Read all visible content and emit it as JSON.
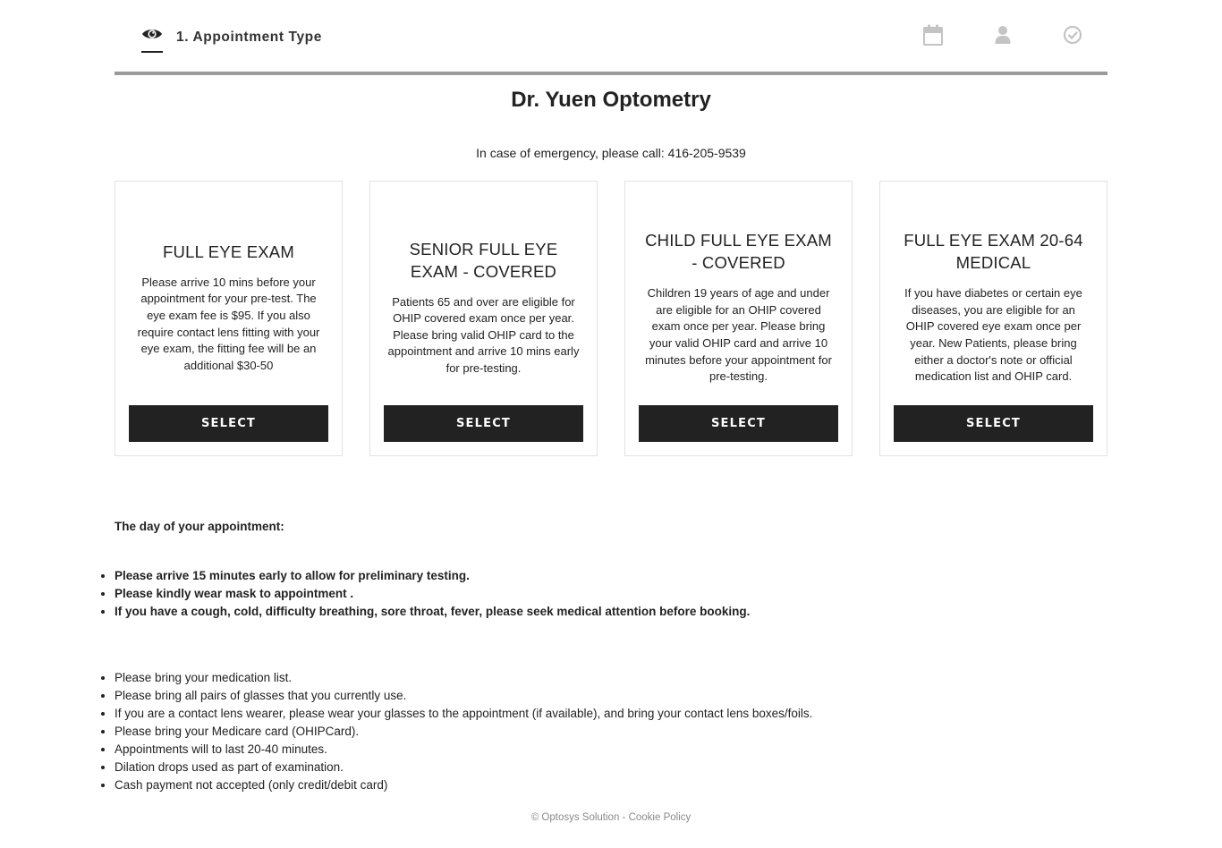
{
  "stepper": {
    "active_step_label": "1. Appointment Type",
    "icons": [
      "eye-icon",
      "calendar-icon",
      "user-icon",
      "check-circle-icon"
    ]
  },
  "clinic": {
    "name": "Dr. Yuen Optometry",
    "emergency_text": "In case of emergency, please call: 416-205-9539"
  },
  "appointment_types": [
    {
      "title": "FULL EYE EXAM",
      "description": "Please arrive 10 mins before your appointment for your pre-test. The eye exam fee is $95. If you also require contact lens fitting with your eye exam, the fitting fee will be an additional $30-50",
      "button_label": "SELECT"
    },
    {
      "title": "SENIOR FULL EYE EXAM - COVERED",
      "description": "Patients 65 and over are eligible for OHIP covered exam once per year. Please bring valid OHIP card to the appointment and arrive 10 mins early for pre-testing.",
      "button_label": "SELECT"
    },
    {
      "title": "CHILD FULL EYE EXAM - COVERED",
      "description": "Children 19 years of age and under are eligible for an OHIP covered exam once per year. Please bring your valid OHIP card and arrive 10 minutes before your appointment for pre-testing.",
      "button_label": "SELECT"
    },
    {
      "title": "FULL EYE EXAM 20-64 MEDICAL",
      "description": "If you have diabetes or certain eye diseases, you are eligible for an OHIP covered eye exam once per year. New Patients, please bring either a doctor's note or official medication list and OHIP card.",
      "button_label": "SELECT"
    }
  ],
  "instructions": {
    "heading": "The day of your appointment:",
    "important": [
      "Please arrive 15 minutes early to allow for preliminary testing.",
      "Please kindly wear mask to appointment .",
      "If you have a cough, cold, difficulty breathing, sore throat, fever, please seek medical attention before booking."
    ],
    "general": [
      "Please bring your medication list.",
      "Please bring all pairs of glasses that you currently use.",
      "If you are a contact lens wearer, please wear your glasses to the appointment (if available), and bring your contact lens boxes/foils.",
      "Please bring your Medicare card (OHIPCard).",
      "Appointments will to last 20-40 minutes.",
      "Dilation drops used as part of examination.",
      "Cash payment not accepted (only credit/debit card)"
    ]
  },
  "footer": {
    "copyright": "© Optosys Solution",
    "separator": " - ",
    "cookie_link": "Cookie Policy"
  }
}
